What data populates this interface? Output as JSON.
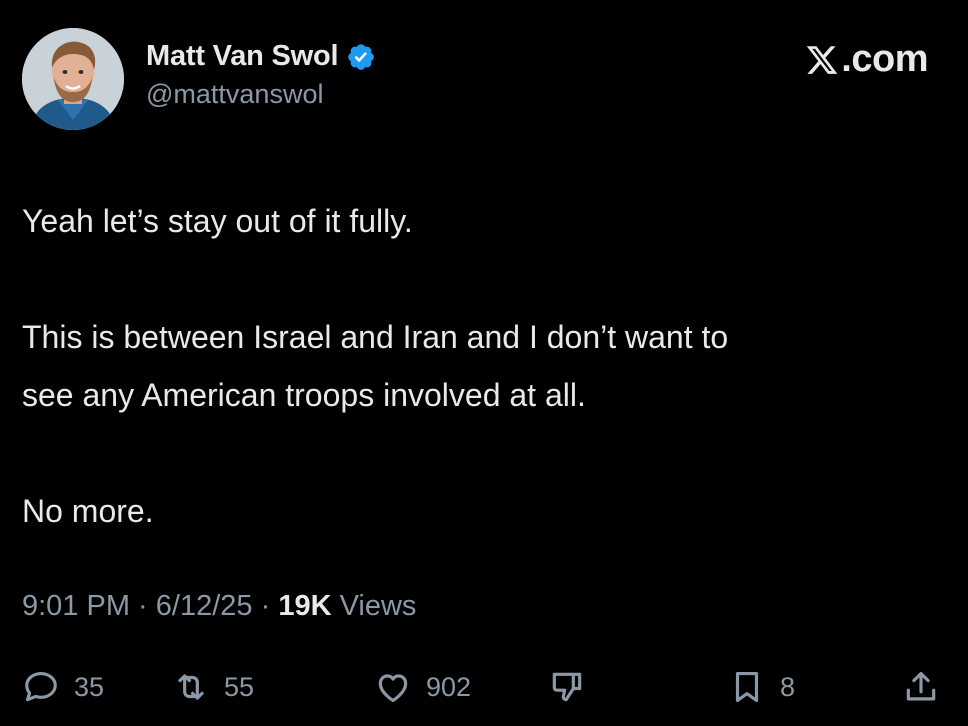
{
  "author": {
    "display_name": "Matt Van Swol",
    "handle": "@mattvanswol",
    "verified": true,
    "verified_color": "#1d9bf0"
  },
  "brand": {
    "label": ".com",
    "logo_icon": "x-logo-icon"
  },
  "tweet": {
    "lines": [
      "Yeah let’s stay out of it fully.",
      "This is between Israel and Iran and I don’t want to",
      "see any American troops involved at all.",
      "No more."
    ]
  },
  "meta": {
    "time": "9:01 PM",
    "sep1": " · ",
    "date": "6/12/25",
    "sep2": " · ",
    "views_count": "19K",
    "views_label": " Views"
  },
  "actions": {
    "replies": "35",
    "reposts": "55",
    "likes": "902",
    "bookmarks": "8"
  },
  "colors": {
    "background": "#000000",
    "text": "#e7e9ea",
    "secondary": "#8b98a5"
  }
}
